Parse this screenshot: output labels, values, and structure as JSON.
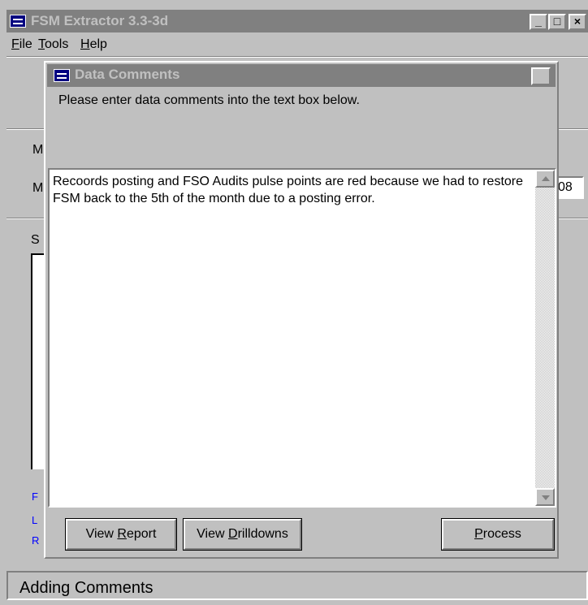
{
  "main_window": {
    "title": "FSM Extractor 3.3-3d",
    "controls": {
      "minimize": "_",
      "maximize": "□",
      "close": "×"
    }
  },
  "menu": {
    "file": {
      "accel": "F",
      "rest": "ile"
    },
    "tools": {
      "accel": "T",
      "rest": "ools"
    },
    "help": {
      "accel": "H",
      "rest": "elp"
    }
  },
  "background_fragments": {
    "frag_1": "M",
    "frag_2": "M",
    "frag_3": "S",
    "field_value": "08",
    "link_f": "F",
    "link_l": "L",
    "link_r": "R"
  },
  "status_bar": {
    "text": "Adding Comments"
  },
  "dialog": {
    "title": "Data Comments",
    "close": "×",
    "instructions": "Please enter data comments into the text box below.",
    "comment": "Recoords posting and FSO Audits pulse points are red because we had to restore FSM back to the 5th of the month due to a posting error.",
    "buttons": {
      "view_report": {
        "pre": "View ",
        "accel": "R",
        "post": "eport"
      },
      "view_drilldowns": {
        "pre": "View ",
        "accel": "D",
        "post": "rilldowns"
      },
      "process": {
        "pre": "",
        "accel": "P",
        "post": "rocess"
      }
    }
  }
}
